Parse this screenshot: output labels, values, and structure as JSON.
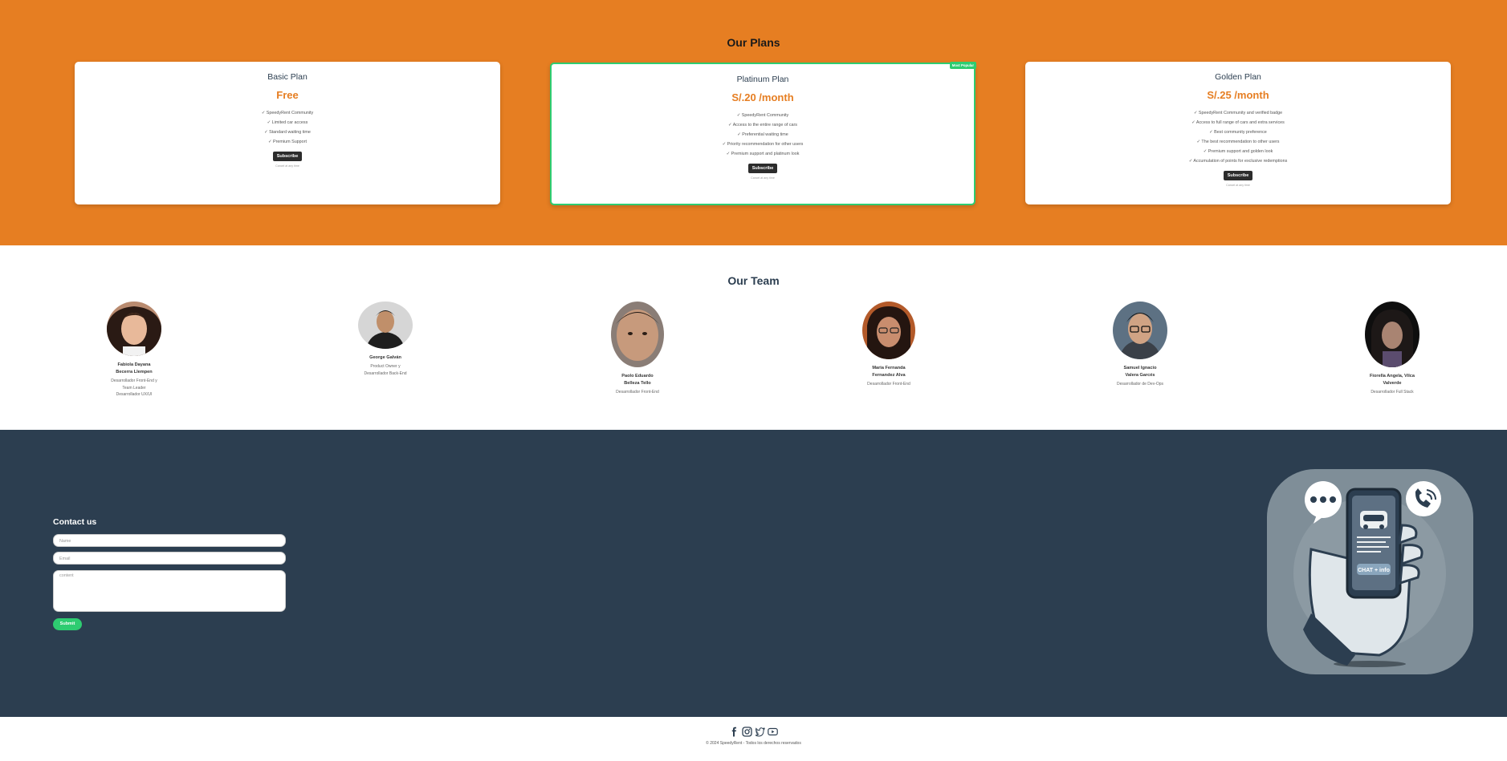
{
  "plans": {
    "title": "Our Plans",
    "basic": {
      "title": "Basic Plan",
      "price": "Free",
      "features": [
        "✓ SpeedyRent Community",
        "✓ Limited car access",
        "✓ Standard waiting time",
        "✓ Premium Support"
      ],
      "button": "Subscribe",
      "note": "Cancel at any time"
    },
    "platinum": {
      "title": "Platinum Plan",
      "price": "S/.20 /month",
      "badge": "Most Popular",
      "features": [
        "✓ SpeedyRent Community",
        "✓ Access to the entire range of cars",
        "✓ Preferential waiting time",
        "✓ Priority recommendation for other users",
        "✓ Premium support and platinum look"
      ],
      "button": "Subscribe",
      "note": "Cancel at any time"
    },
    "golden": {
      "title": "Golden Plan",
      "price": "S/.25 /month",
      "features": [
        "✓ SpeedyRent Community and verified badge",
        "✓ Access to full range of cars and extra services",
        "✓ Best community preference",
        "✓ The best recommendation to other users",
        "✓ Premium support and golden look",
        "✓ Accumulation of points for exclusive redemptions"
      ],
      "button": "Subscribe",
      "note": "Cancel at any time"
    }
  },
  "team": {
    "title": "Our Team",
    "members": [
      {
        "name_1": "Fabiola Dayana",
        "name_2": "Becerra Llempen",
        "role_1": "Desarrollador Front-End y",
        "role_2": "Team Leader",
        "role_3": "Desarrollador UX/UI"
      },
      {
        "name_1": "George Galván",
        "role_1": "Product Owner y",
        "role_2": "Desarrollador Back-End"
      },
      {
        "name_1": "Paolo Eduardo",
        "name_2": "Belleza Tello",
        "role_1": "Desarrollador Front-End"
      },
      {
        "name_1": "Maria Fernanda",
        "name_2": "Fernandez Alva",
        "role_1": "Desarrollador Front-End"
      },
      {
        "name_1": "Samuel Ignacio",
        "name_2": "Valera Garcés",
        "role_1": "Desarrollador de Dev-Ops"
      },
      {
        "name_1": "Fiorella Angela, Vilca",
        "name_2": "Valverde",
        "role_1": "Desarrollador Full Stack"
      }
    ]
  },
  "contact": {
    "title": "Contact us",
    "name_placeholder": "Name",
    "email_placeholder": "Email",
    "content_placeholder": "content",
    "submit": "Submit",
    "illustration_text": "CHAT + info"
  },
  "footer": {
    "copyright": "© 2024 SpeedyRent - Todos los derechos reservados",
    "icons": [
      "facebook-icon",
      "instagram-icon",
      "twitter-icon",
      "youtube-icon"
    ]
  },
  "colors": {
    "orange": "#e67e22",
    "navy": "#2c3e50",
    "green": "#2ecc71"
  }
}
